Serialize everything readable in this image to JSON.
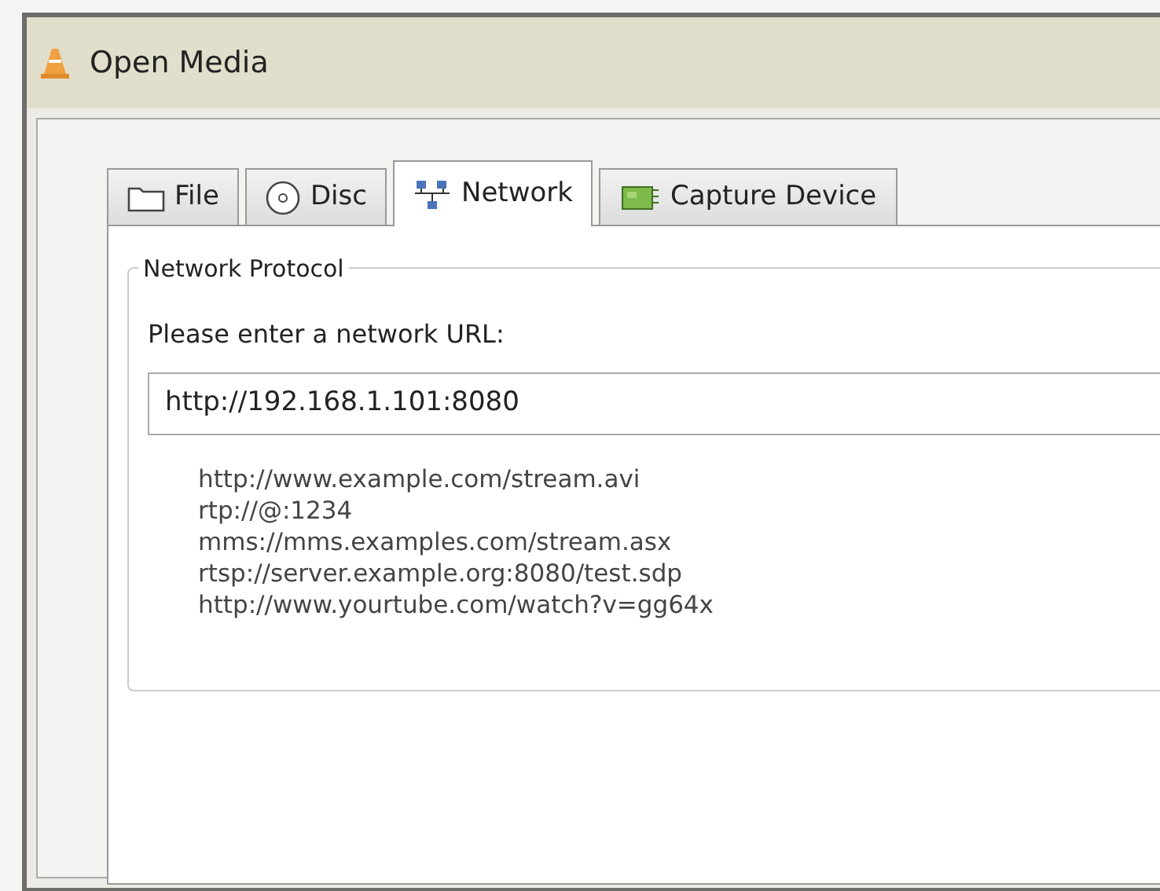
{
  "window": {
    "title": "Open Media"
  },
  "tabs": [
    {
      "label": "File",
      "kind": "file",
      "selected": false
    },
    {
      "label": "Disc",
      "kind": "disc",
      "selected": false
    },
    {
      "label": "Network",
      "kind": "network",
      "selected": true
    },
    {
      "label": "Capture Device",
      "kind": "capture",
      "selected": false
    }
  ],
  "group": {
    "title": "Network Protocol",
    "prompt": "Please enter a network URL:",
    "url_field": {
      "value": "http://192.168.1.101:8080"
    },
    "examples": [
      "http://www.example.com/stream.avi",
      "rtp://@:1234",
      "mms://mms.examples.com/stream.asx",
      "rtsp://server.example.org:8080/test.sdp",
      "http://www.yourtube.com/watch?v=gg64x"
    ]
  }
}
